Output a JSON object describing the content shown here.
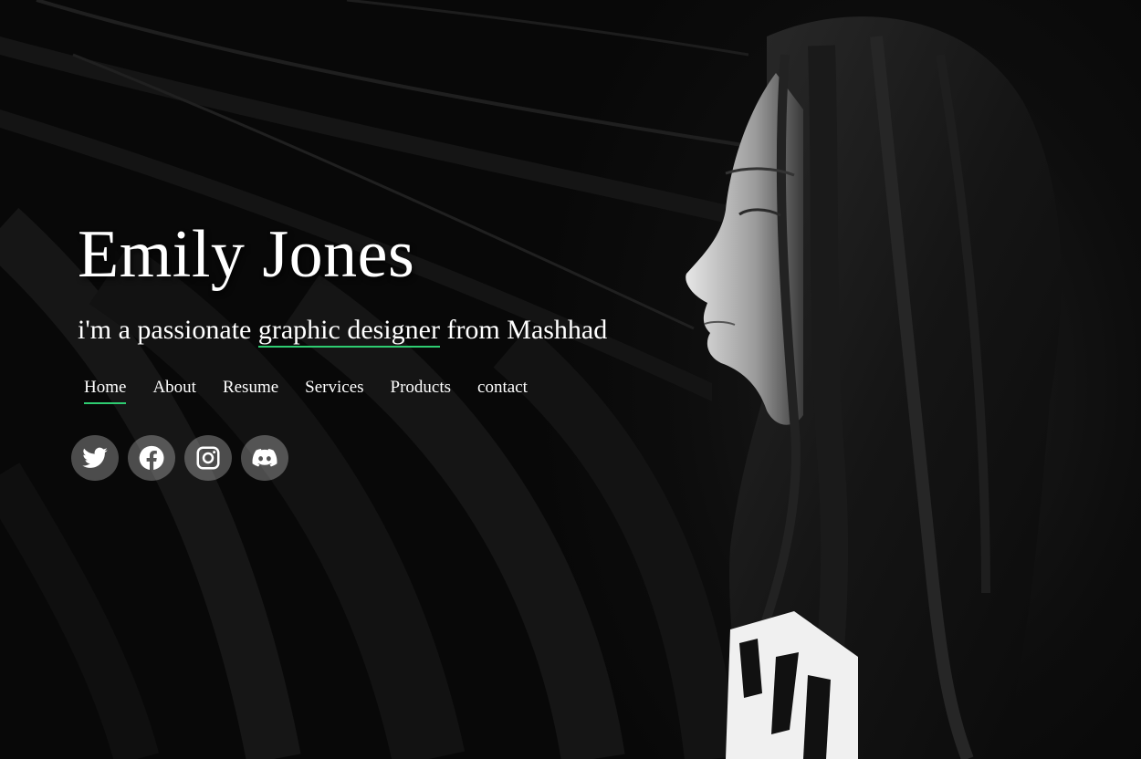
{
  "hero": {
    "name": "Emily Jones",
    "tagline_before": "i'm a passionate ",
    "tagline_highlight": "graphic designer",
    "tagline_after": " from Mashhad"
  },
  "nav": {
    "items": [
      {
        "label": "Home",
        "active": true
      },
      {
        "label": "About",
        "active": false
      },
      {
        "label": "Resume",
        "active": false
      },
      {
        "label": "Services",
        "active": false
      },
      {
        "label": "Products",
        "active": false
      },
      {
        "label": "contact",
        "active": false
      }
    ]
  },
  "socials": [
    {
      "icon": "twitter-icon"
    },
    {
      "icon": "facebook-icon"
    },
    {
      "icon": "instagram-icon"
    },
    {
      "icon": "discord-icon"
    }
  ],
  "colors": {
    "accent": "#2ecc71",
    "background": "#0b0b0b",
    "text": "#ffffff",
    "social_bg": "rgba(255,255,255,0.28)"
  }
}
